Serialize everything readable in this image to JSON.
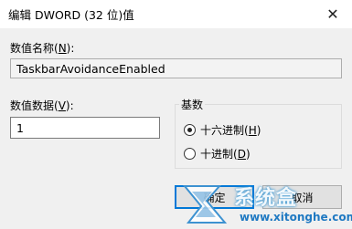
{
  "window": {
    "title": "编辑 DWORD (32 位)值",
    "close_glyph": "✕"
  },
  "value_name": {
    "label_pre": "数值名称(",
    "label_key": "N",
    "label_post": "):",
    "value": "TaskbarAvoidanceEnabled"
  },
  "value_data": {
    "label_pre": "数值数据(",
    "label_key": "V",
    "label_post": "):",
    "value": "1"
  },
  "base": {
    "title": "基数",
    "options": [
      {
        "label_pre": "十六进制(",
        "label_key": "H",
        "label_post": ")",
        "checked": true
      },
      {
        "label_pre": "十进制(",
        "label_key": "D",
        "label_post": ")",
        "checked": false
      }
    ]
  },
  "buttons": {
    "ok_label": "确定",
    "cancel_label": "取消"
  },
  "watermark": {
    "text": "系统盒",
    "url": "www.xitonghe.com"
  }
}
